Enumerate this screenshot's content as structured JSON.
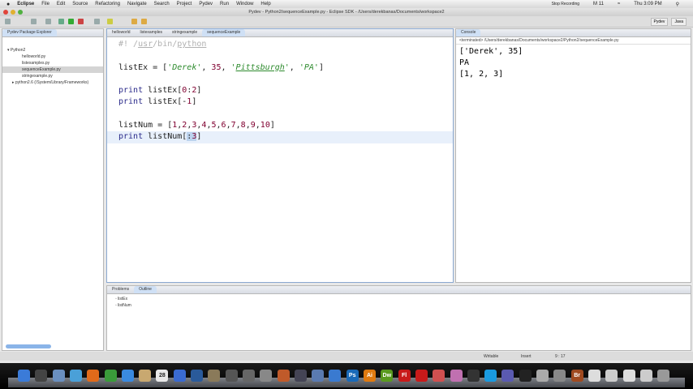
{
  "menubar": {
    "app": "Eclipse",
    "items": [
      "File",
      "Edit",
      "Source",
      "Refactoring",
      "Navigate",
      "Search",
      "Project",
      "Pydev",
      "Run",
      "Window",
      "Help"
    ],
    "status": [
      "Stop Recording",
      "M 11",
      "Thu 3:09 PM"
    ]
  },
  "window_title": "Pydev - Python2/sequenceExample.py - Eclipse SDK - /Users/derekbanas/Documents/workspace2",
  "perspectives": [
    "Pydev",
    "Java"
  ],
  "explorer": {
    "title": "Pydev Package Explorer",
    "project": "Python2",
    "files": [
      "helloworld.py",
      "listexamples.py",
      "sequenceExample.py",
      "stringexample.py"
    ],
    "selected": 2,
    "interpreter": "python2.6  (/System/Library/Frameworks)"
  },
  "editor": {
    "tabs": [
      "helloworld",
      "listexamples",
      "stringexample",
      "sequenceExample"
    ],
    "active": 3
  },
  "console": {
    "title": "Console",
    "terminated": "<terminated> /Users/derekbanas/Documents/workspace2/Python2/sequenceExample.py",
    "output": [
      "['Derek', 35]",
      "PA",
      "[1, 2, 3]"
    ]
  },
  "bottom": {
    "tabs": [
      "Problems",
      "Outline"
    ],
    "outline": [
      "listEx",
      "listNum"
    ]
  },
  "statusbar": {
    "writable": "Writable",
    "mode": "Insert",
    "position": "9 : 17"
  },
  "dock": {
    "icons": [
      [
        "finder",
        "#3b7bd8",
        ""
      ],
      [
        "dashboard",
        "#444",
        ""
      ],
      [
        "preview",
        "#6a8fbf",
        ""
      ],
      [
        "safari",
        "#4aa0d8",
        ""
      ],
      [
        "firefox",
        "#e06a1a",
        ""
      ],
      [
        "chrome",
        "#3a9a3a",
        ""
      ],
      [
        "ichat",
        "#3a8ae0",
        ""
      ],
      [
        "textedit",
        "#c8a870",
        ""
      ],
      [
        "ical",
        "#e8e8e8",
        "28"
      ],
      [
        "itunes",
        "#3a6ad0",
        ""
      ],
      [
        "quicktime",
        "#2a5a9a",
        ""
      ],
      [
        "iphoto",
        "#8a7a5a",
        ""
      ],
      [
        "imovie",
        "#555",
        ""
      ],
      [
        "photo-booth",
        "#666",
        ""
      ],
      [
        "system-prefs",
        "#888",
        ""
      ],
      [
        "keynote",
        "#c05a2a",
        ""
      ],
      [
        "xcode",
        "#445",
        ""
      ],
      [
        "instruments",
        "#5a7ab0",
        ""
      ],
      [
        "xcode-blue",
        "#3a7ad0",
        ""
      ],
      [
        "photoshop",
        "#1a6ab8",
        "Ps"
      ],
      [
        "illustrator",
        "#e07a10",
        "Ai"
      ],
      [
        "dreamweaver",
        "#5a9a20",
        "Dw"
      ],
      [
        "flash",
        "#c81a1a",
        "Fl"
      ],
      [
        "acrobat",
        "#c81a1a",
        ""
      ],
      [
        "reader",
        "#d05050",
        ""
      ],
      [
        "app-pink",
        "#c070b0",
        ""
      ],
      [
        "clapper",
        "#333",
        ""
      ],
      [
        "skype",
        "#1a9ae0",
        ""
      ],
      [
        "browser",
        "#5a5ab0",
        ""
      ],
      [
        "terminal",
        "#222",
        ""
      ],
      [
        "calculator",
        "#aaa",
        ""
      ],
      [
        "script",
        "#888",
        ""
      ],
      [
        "bridge",
        "#a04a20",
        "Br"
      ],
      [
        "doc",
        "#ddd",
        ""
      ],
      [
        "notes",
        "#ccc",
        ""
      ],
      [
        "stack",
        "#ddd",
        ""
      ],
      [
        "downloads",
        "#ccc",
        ""
      ],
      [
        "trash",
        "#999",
        ""
      ]
    ]
  }
}
